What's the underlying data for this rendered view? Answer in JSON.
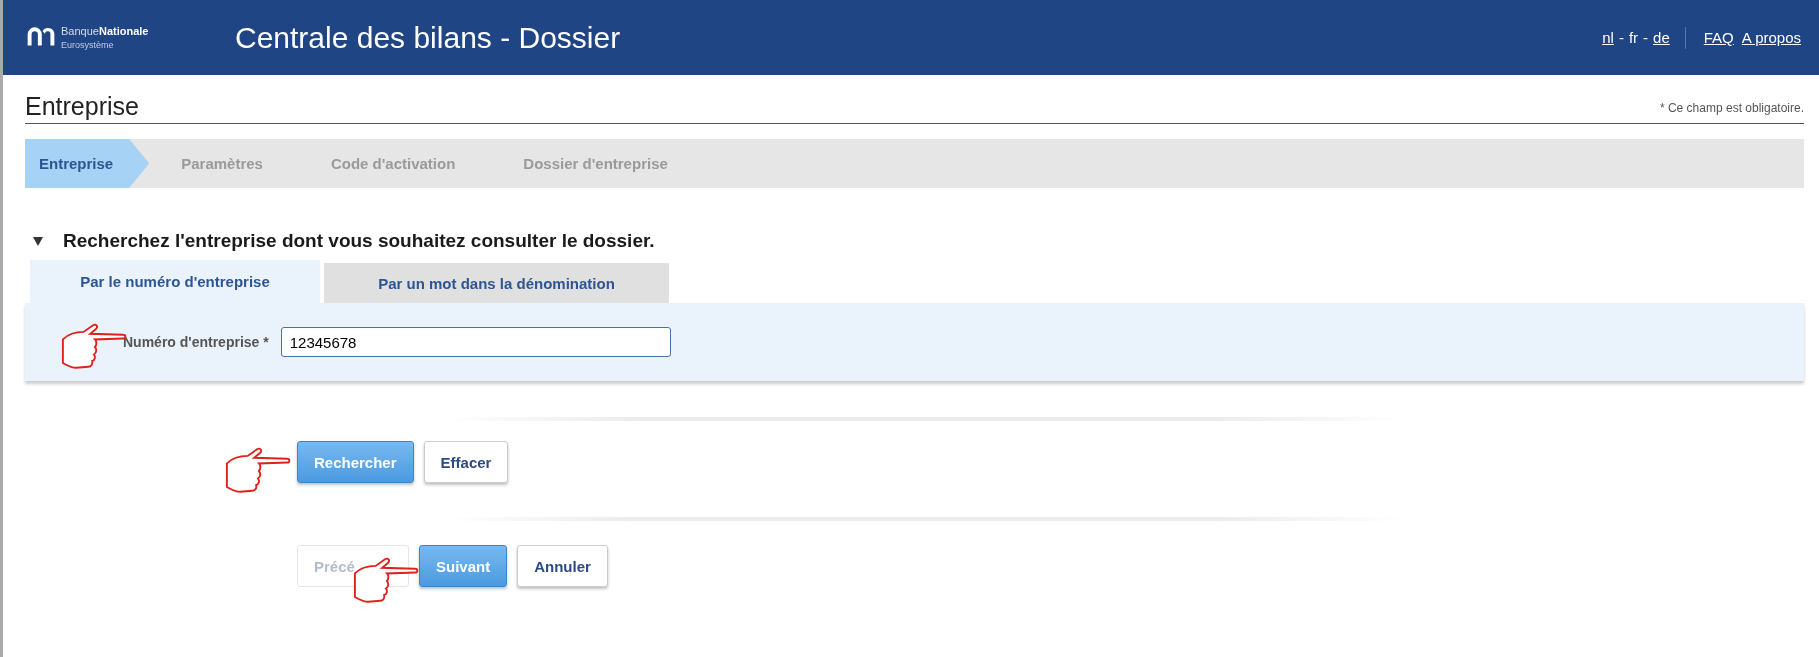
{
  "header": {
    "logo": {
      "brand_light": "Banque",
      "brand_bold": "Nationale",
      "tagline": "Eurosystème"
    },
    "title": "Centrale des bilans - Dossier",
    "language_separator": "-",
    "languages": [
      {
        "label": "nl",
        "selected": false
      },
      {
        "label": "fr",
        "selected": true
      },
      {
        "label": "de",
        "selected": false
      }
    ],
    "links": [
      "FAQ",
      "A propos"
    ]
  },
  "page_title": "Entreprise",
  "required_note": "* Ce champ est obligatoire.",
  "steps": [
    {
      "label": "Entreprise",
      "selected": true
    },
    {
      "label": "Paramètres",
      "selected": false
    },
    {
      "label": "Code d'activation",
      "selected": false
    },
    {
      "label": "Dossier d'entreprise",
      "selected": false
    }
  ],
  "section": {
    "expanded": true,
    "title": "Recherchez l'entreprise dont vous souhaitez consulter le dossier."
  },
  "tabs": [
    {
      "label": "Par le numéro d'entreprise",
      "selected": true
    },
    {
      "label": "Par un mot dans la dénomination",
      "selected": false
    }
  ],
  "field": {
    "label": "Numéro d'entreprise *",
    "value": "12345678"
  },
  "search_buttons": [
    {
      "label": "Rechercher",
      "kind": "primary",
      "disabled": false
    },
    {
      "label": "Effacer",
      "kind": "default",
      "disabled": false
    }
  ],
  "nav_buttons": [
    {
      "label": "Précé",
      "kind": "default",
      "disabled": true
    },
    {
      "label": "Suivant",
      "kind": "primary",
      "disabled": false
    },
    {
      "label": "Annuler",
      "kind": "default",
      "disabled": false
    }
  ]
}
